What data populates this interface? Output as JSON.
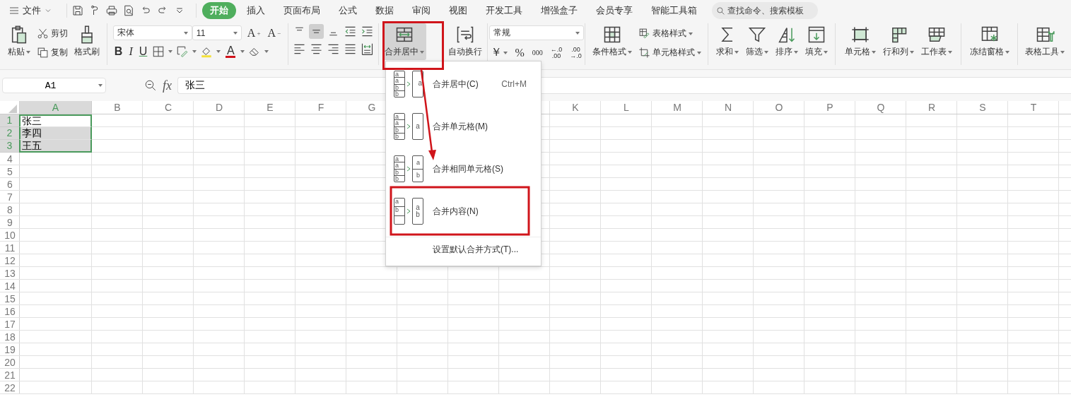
{
  "file_menu": {
    "label": "文件"
  },
  "tabs": [
    {
      "label": "开始",
      "selected": true
    },
    {
      "label": "插入",
      "selected": false
    },
    {
      "label": "页面布局",
      "selected": false
    },
    {
      "label": "公式",
      "selected": false
    },
    {
      "label": "数据",
      "selected": false
    },
    {
      "label": "审阅",
      "selected": false
    },
    {
      "label": "视图",
      "selected": false
    },
    {
      "label": "开发工具",
      "selected": false
    },
    {
      "label": "增强盒子",
      "selected": false
    },
    {
      "label": "会员专享",
      "selected": false
    },
    {
      "label": "智能工具箱",
      "selected": false
    }
  ],
  "search": {
    "placeholder": "查找命令、搜索模板"
  },
  "ribbon": {
    "groups": [
      {
        "kind": "buttons",
        "items": [
          {
            "label": "粘贴",
            "kind": "large",
            "dropdown": true,
            "pressed": false
          },
          {
            "label": "剪切",
            "kind": "small",
            "dropdown": false,
            "pressed": false
          },
          {
            "label": "复制",
            "kind": "small",
            "dropdown": false,
            "pressed": false
          },
          {
            "label": "格式刷",
            "kind": "large",
            "dropdown": false,
            "pressed": false
          }
        ]
      },
      {
        "kind": "font",
        "font_name": "宋体",
        "font_size": "11",
        "grow": {
          "letter": "A",
          "sign": "+"
        },
        "shrink": {
          "letter": "A",
          "sign": "−"
        },
        "bold": "B",
        "italic": "I",
        "underline": "U",
        "font_color": "A"
      },
      {
        "kind": "alignment",
        "buttons": [
          {
            "pressed": false
          },
          {
            "pressed": true
          },
          {
            "pressed": false
          },
          {
            "pressed": false
          },
          {
            "pressed": false
          },
          {
            "pressed": false
          },
          {
            "pressed": false
          },
          {
            "pressed": false
          },
          {
            "pressed": false
          },
          {
            "pressed": false
          }
        ]
      },
      {
        "kind": "buttons",
        "items": [
          {
            "label": "合并居中",
            "kind": "large",
            "dropdown": true,
            "pressed": true
          },
          {
            "label": "自动换行",
            "kind": "large",
            "dropdown": false,
            "pressed": false
          }
        ]
      },
      {
        "kind": "number",
        "format": "常规",
        "currency": "￥",
        "percent": "%",
        "thousands": "000",
        "increase_decimal": {
          "top": "←.0",
          "bottom": ".00"
        },
        "decrease_decimal": {
          "top": ".00",
          "bottom": "→.0"
        }
      },
      {
        "kind": "buttons",
        "items": [
          {
            "label": "条件格式",
            "kind": "large",
            "dropdown": true,
            "pressed": false
          },
          {
            "label": "表格样式",
            "kind": "small",
            "dropdown": true,
            "pressed": false
          },
          {
            "label": "单元格样式",
            "kind": "small",
            "dropdown": true,
            "pressed": false
          }
        ]
      },
      {
        "kind": "buttons",
        "items": [
          {
            "label": "求和",
            "kind": "large",
            "dropdown": true,
            "pressed": false
          },
          {
            "label": "筛选",
            "kind": "large",
            "dropdown": true,
            "pressed": false
          },
          {
            "label": "排序",
            "kind": "large",
            "dropdown": true,
            "pressed": false
          },
          {
            "label": "填充",
            "kind": "large",
            "dropdown": true,
            "pressed": false
          }
        ]
      },
      {
        "kind": "buttons",
        "items": [
          {
            "label": "单元格",
            "kind": "large",
            "dropdown": true,
            "pressed": false
          },
          {
            "label": "行和列",
            "kind": "large",
            "dropdown": true,
            "pressed": false
          },
          {
            "label": "工作表",
            "kind": "large",
            "dropdown": true,
            "pressed": false
          }
        ]
      },
      {
        "kind": "buttons",
        "items": [
          {
            "label": "冻结窗格",
            "kind": "large",
            "dropdown": true,
            "pressed": false
          }
        ]
      },
      {
        "kind": "buttons",
        "items": [
          {
            "label": "表格工具",
            "kind": "large",
            "dropdown": true,
            "pressed": false
          }
        ]
      }
    ]
  },
  "formula_bar": {
    "name_box": "A1",
    "fx": "fx",
    "formula": "张三"
  },
  "grid": {
    "columns": [
      {
        "label": "A",
        "selected": true
      },
      {
        "label": "B",
        "selected": false
      },
      {
        "label": "C",
        "selected": false
      },
      {
        "label": "D",
        "selected": false
      },
      {
        "label": "E",
        "selected": false
      },
      {
        "label": "F",
        "selected": false
      },
      {
        "label": "G",
        "selected": false
      },
      {
        "label": "K",
        "selected": false
      },
      {
        "label": "L",
        "selected": false
      },
      {
        "label": "M",
        "selected": false
      },
      {
        "label": "N",
        "selected": false
      },
      {
        "label": "O",
        "selected": false
      },
      {
        "label": "P",
        "selected": false
      },
      {
        "label": "Q",
        "selected": false
      },
      {
        "label": "R",
        "selected": false
      },
      {
        "label": "S",
        "selected": false
      },
      {
        "label": "T",
        "selected": false
      }
    ],
    "rows": [
      {
        "label": "1",
        "selected": true,
        "cells": [
          {
            "text": "张三",
            "selected": true,
            "active": true
          }
        ]
      },
      {
        "label": "2",
        "selected": true,
        "cells": [
          {
            "text": "李四",
            "selected": true,
            "active": false
          }
        ]
      },
      {
        "label": "3",
        "selected": true,
        "cells": [
          {
            "text": "王五",
            "selected": true,
            "active": false
          }
        ]
      },
      {
        "label": "4",
        "selected": false
      },
      {
        "label": "5",
        "selected": false
      },
      {
        "label": "6",
        "selected": false
      },
      {
        "label": "7",
        "selected": false
      },
      {
        "label": "8",
        "selected": false
      },
      {
        "label": "9",
        "selected": false
      },
      {
        "label": "10",
        "selected": false
      },
      {
        "label": "11",
        "selected": false
      },
      {
        "label": "12",
        "selected": false
      },
      {
        "label": "13",
        "selected": false
      },
      {
        "label": "14",
        "selected": false
      },
      {
        "label": "15",
        "selected": false
      },
      {
        "label": "16",
        "selected": false
      },
      {
        "label": "17",
        "selected": false
      },
      {
        "label": "18",
        "selected": false
      },
      {
        "label": "19",
        "selected": false
      },
      {
        "label": "20",
        "selected": false
      },
      {
        "label": "21",
        "selected": false
      },
      {
        "label": "22",
        "selected": false
      }
    ]
  },
  "merge_menu": {
    "items": [
      {
        "kind": "merge-center",
        "label": "合并居中(C)",
        "shortcut": "Ctrl+M",
        "icon_left": [
          "a",
          "a",
          "b",
          "b"
        ],
        "icon_right": [
          "a"
        ]
      },
      {
        "kind": "merge-cells",
        "label": "合并单元格(M)",
        "icon_left": [
          "a",
          "a",
          "b",
          "b"
        ],
        "icon_right": [
          "a"
        ]
      },
      {
        "kind": "merge-same",
        "label": "合并相同单元格(S)",
        "icon_left": [
          "a",
          "a",
          "b",
          "b"
        ],
        "icon_right": [
          "a",
          "b"
        ]
      },
      {
        "kind": "merge-content",
        "label": "合并内容(N)",
        "icon_left": [
          "a",
          "b"
        ],
        "icon_right": [
          "a",
          "b"
        ]
      },
      {
        "kind": "setting",
        "label": "设置默认合并方式(T)..."
      }
    ]
  }
}
